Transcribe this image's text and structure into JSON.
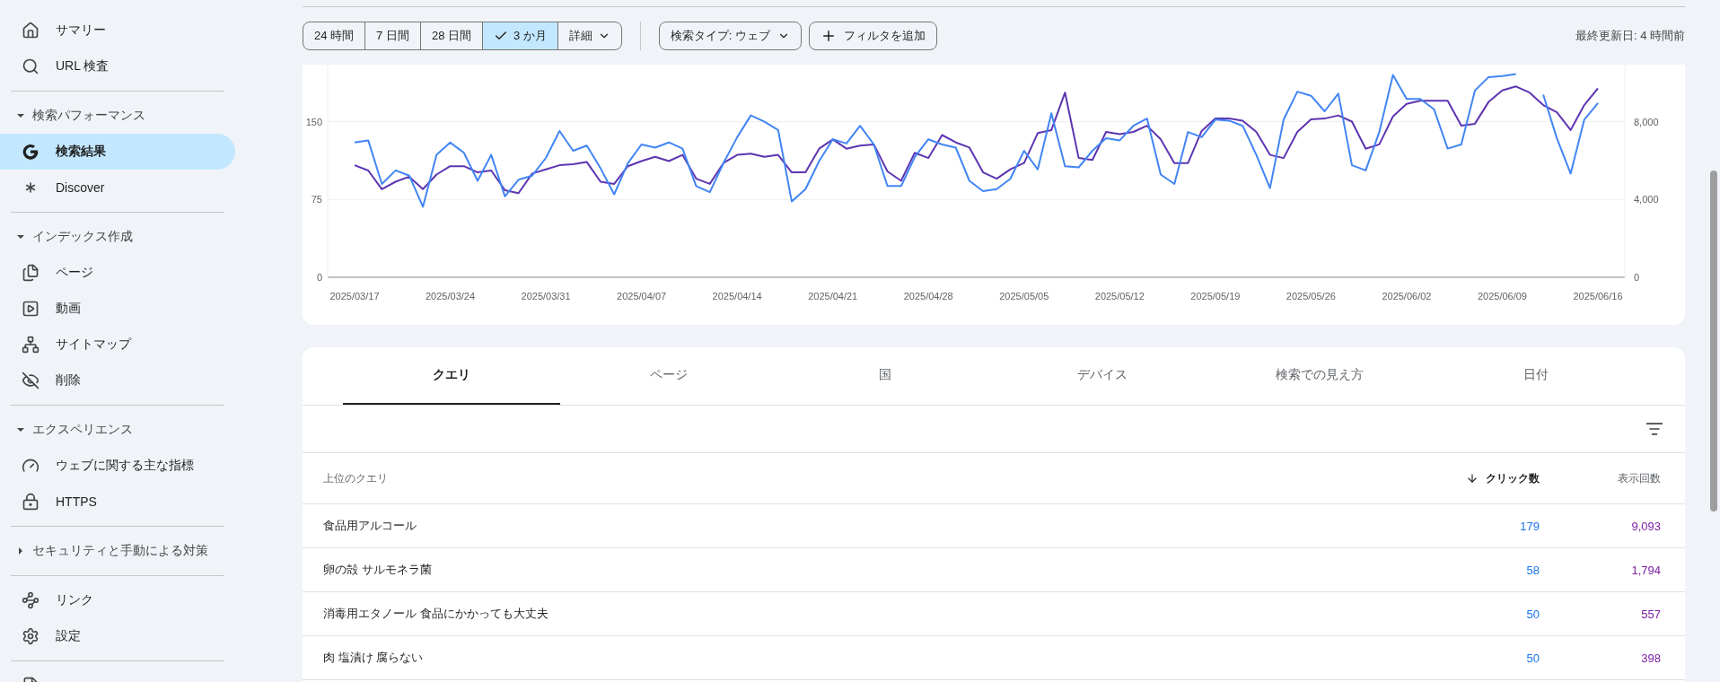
{
  "sidebar": {
    "entries": [
      {
        "kind": "item",
        "label": "サマリー",
        "selected": false
      },
      {
        "kind": "item",
        "label": "URL 検査",
        "selected": false
      },
      {
        "kind": "divider"
      },
      {
        "kind": "section",
        "label": "検索パフォーマンス",
        "expanded": true
      },
      {
        "kind": "item",
        "label": "検索結果",
        "selected": true
      },
      {
        "kind": "item",
        "label": "Discover",
        "selected": false
      },
      {
        "kind": "divider"
      },
      {
        "kind": "section",
        "label": "インデックス作成",
        "expanded": true
      },
      {
        "kind": "item",
        "label": "ページ",
        "selected": false
      },
      {
        "kind": "item",
        "label": "動画",
        "selected": false
      },
      {
        "kind": "item",
        "label": "サイトマップ",
        "selected": false
      },
      {
        "kind": "item",
        "label": "削除",
        "selected": false
      },
      {
        "kind": "divider"
      },
      {
        "kind": "section",
        "label": "エクスペリエンス",
        "expanded": true
      },
      {
        "kind": "item",
        "label": "ウェブに関する主な指標",
        "selected": false
      },
      {
        "kind": "item",
        "label": "HTTPS",
        "selected": false
      },
      {
        "kind": "divider"
      },
      {
        "kind": "section",
        "label": "セキュリティと手動による対策",
        "expanded": false
      },
      {
        "kind": "divider"
      },
      {
        "kind": "item",
        "label": "リンク",
        "selected": false
      },
      {
        "kind": "item",
        "label": "設定",
        "selected": false
      },
      {
        "kind": "divider"
      },
      {
        "kind": "item",
        "selected": false
      }
    ]
  },
  "toolbar": {
    "ranges": [
      {
        "label": "24 時間",
        "selected": false
      },
      {
        "label": "7 日間",
        "selected": false
      },
      {
        "label": "28 日間",
        "selected": false
      },
      {
        "label": "3 か月",
        "selected": true
      },
      {
        "label": "詳細",
        "selected": false
      }
    ],
    "search_type": "検索タイプ: ウェブ",
    "add_filter": "フィルタを追加",
    "last_updated": "最終更新日: 4 時間前"
  },
  "chart_data": {
    "type": "line",
    "categories": [
      "2025/03/17",
      null,
      null,
      null,
      null,
      null,
      null,
      "2025/03/24",
      null,
      null,
      null,
      null,
      null,
      null,
      "2025/03/31",
      null,
      null,
      null,
      null,
      null,
      null,
      "2025/04/07",
      null,
      null,
      null,
      null,
      null,
      null,
      "2025/04/14",
      null,
      null,
      null,
      null,
      null,
      null,
      "2025/04/21",
      null,
      null,
      null,
      null,
      null,
      null,
      "2025/04/28",
      null,
      null,
      null,
      null,
      null,
      null,
      "2025/05/05",
      null,
      null,
      null,
      null,
      null,
      null,
      "2025/05/12",
      null,
      null,
      null,
      null,
      null,
      null,
      "2025/05/19",
      null,
      null,
      null,
      null,
      null,
      null,
      "2025/05/26",
      null,
      null,
      null,
      null,
      null,
      null,
      "2025/06/02",
      null,
      null,
      null,
      null,
      null,
      null,
      "2025/06/09",
      null,
      null,
      null,
      null,
      null,
      null,
      "2025/06/16"
    ],
    "ylim": [
      0,
      205
    ],
    "y2lim": [
      0,
      10930
    ],
    "yticks": [
      0,
      75,
      150
    ],
    "y2ticks": [
      {
        "value": 0,
        "label": "0"
      },
      {
        "value": 4000,
        "label": "4,000"
      },
      {
        "value": 8000,
        "label": "8,000"
      }
    ],
    "series": [
      {
        "axis": "y2",
        "color": "#5e35b1",
        "values": [
          5760,
          5490,
          4530,
          4910,
          5170,
          4530,
          5280,
          5710,
          5710,
          5390,
          5490,
          4480,
          4320,
          5330,
          5550,
          5760,
          5810,
          5920,
          4910,
          4800,
          5710,
          5970,
          6190,
          5970,
          6290,
          5070,
          4800,
          5870,
          6290,
          6350,
          6190,
          6290,
          5390,
          5390,
          6610,
          7090,
          6610,
          6770,
          6830,
          5440,
          4960,
          6400,
          6130,
          7310,
          6930,
          6670,
          5390,
          5070,
          5550,
          5870,
          7410,
          7570,
          9490,
          6130,
          6030,
          7470,
          7360,
          7470,
          7790,
          7090,
          5870,
          5870,
          7520,
          8160,
          8160,
          8050,
          7470,
          6290,
          6130,
          7470,
          8110,
          8160,
          8320,
          8000,
          6610,
          6830,
          8270,
          8910,
          9070,
          9070,
          9070,
          7790,
          7890,
          9010,
          9600,
          9810,
          9490,
          8850,
          8480,
          7570,
          8850,
          9710
        ]
      },
      {
        "color": "#4285f4",
        "values": [
          130,
          132,
          90,
          103,
          98,
          68,
          118,
          130,
          120,
          93,
          118,
          78,
          94,
          98,
          115,
          141,
          122,
          127,
          105,
          80,
          110,
          128,
          125,
          130,
          124,
          88,
          82,
          110,
          135,
          156,
          150,
          142,
          73,
          85,
          112,
          133,
          129,
          146,
          128,
          88,
          88,
          116,
          133,
          128,
          125,
          93,
          83,
          85,
          95,
          122,
          104,
          158,
          107,
          106,
          122,
          134,
          132,
          146,
          153,
          99,
          90,
          140,
          135,
          152,
          151,
          146,
          118,
          86,
          152,
          179,
          175,
          160,
          177,
          108,
          103,
          140,
          195,
          172,
          172,
          162,
          124,
          128,
          180,
          193,
          194,
          196,
          null,
          176,
          134,
          100,
          152,
          168
        ]
      }
    ]
  },
  "report": {
    "tabs": [
      {
        "label": "クエリ",
        "selected": true
      },
      {
        "label": "ページ",
        "selected": false
      },
      {
        "label": "国",
        "selected": false
      },
      {
        "label": "デバイス",
        "selected": false
      },
      {
        "label": "検索での見え方",
        "selected": false
      },
      {
        "label": "日付",
        "selected": false
      }
    ],
    "columns": [
      {
        "label": "上位のクエリ",
        "sorted": false
      },
      {
        "label": "クリック数",
        "sorted": true
      },
      {
        "label": "表示回数",
        "sorted": false
      }
    ],
    "rows": [
      {
        "query": "食品用アルコール",
        "clicks": "179",
        "impressions": "9,093"
      },
      {
        "query": "卵の殻 サルモネラ菌",
        "clicks": "58",
        "impressions": "1,794"
      },
      {
        "query": "消毒用エタノール 食品にかかっても大丈夫",
        "clicks": "50",
        "impressions": "557"
      },
      {
        "query": "肉 塩漬け 腐らない",
        "clicks": "50",
        "impressions": "398"
      }
    ]
  }
}
